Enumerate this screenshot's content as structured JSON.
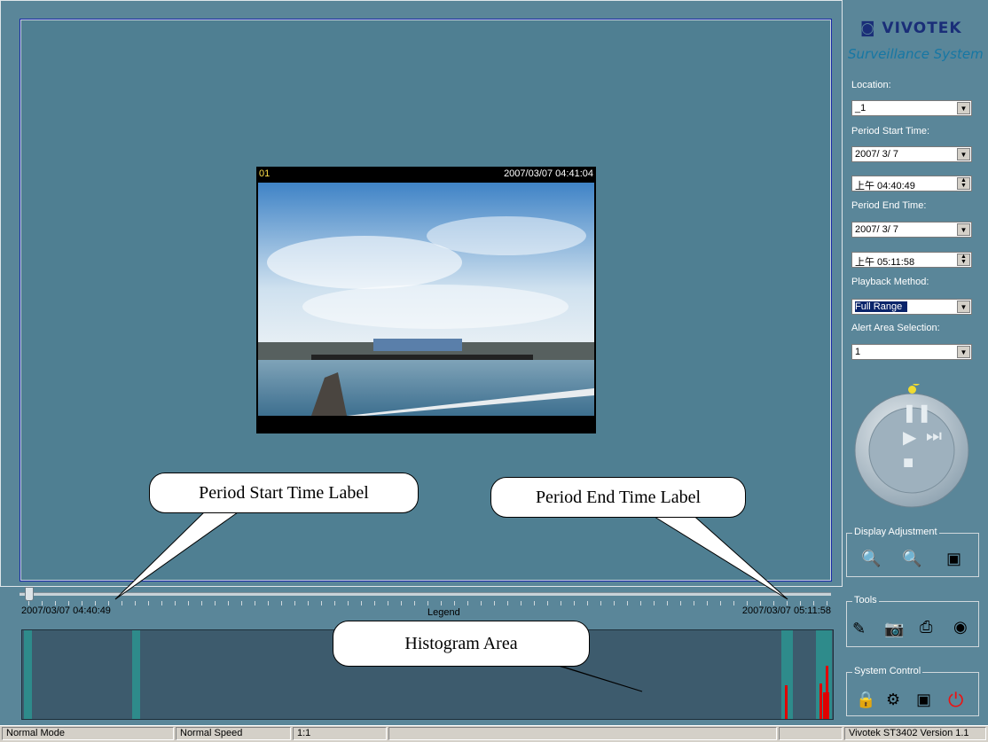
{
  "video": {
    "channel": "01",
    "timestamp": "2007/03/07 04:41:04"
  },
  "timeline": {
    "start_label": "2007/03/07 04:40:49",
    "end_label": "2007/03/07 05:11:58",
    "legend": "Legend"
  },
  "callouts": {
    "start": "Period Start Time Label",
    "end": "Period End Time Label",
    "histogram": "Histogram Area"
  },
  "sidebar": {
    "brand": "VIVOTEK",
    "subtitle": "Surveillance System",
    "location_label": "Location:",
    "location_value": "_1",
    "period_start_label": "Period Start Time:",
    "period_start_date": "2007/ 3/ 7",
    "period_start_time": "上午 04:40:49",
    "period_end_label": "Period End Time:",
    "period_end_date": "2007/ 3/ 7",
    "period_end_time": "上午 05:11:58",
    "playback_label": "Playback Method:",
    "playback_value": "Full Range",
    "alert_label": "Alert Area Selection:",
    "alert_value": "1",
    "display_adjustment": "Display Adjustment",
    "tools": "Tools",
    "system_control": "System Control"
  },
  "statusbar": {
    "mode": "Normal Mode",
    "speed": "Normal Speed",
    "ratio": "1:1",
    "version": "Vivotek ST3402   Version 1.1"
  }
}
